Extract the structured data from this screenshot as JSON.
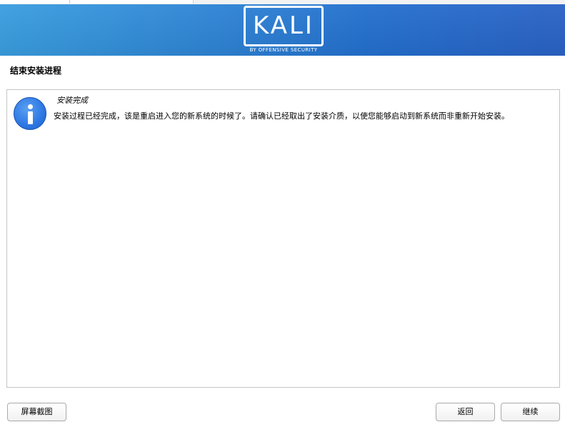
{
  "header": {
    "logo_text": "KALI",
    "logo_subtitle": "BY OFFENSIVE SECURITY",
    "gradient_colors": [
      "#3a9ee0",
      "#2370cf",
      "#2a62c6"
    ]
  },
  "step": {
    "title": "结束安装进程"
  },
  "message": {
    "icon": "info-icon",
    "title": "安装完成",
    "body": "安装过程已经完成，该是重启进入您的新系统的时候了。请确认已经取出了安装介质，以使您能够启动到新系统而非重新开始安装。"
  },
  "buttons": {
    "screenshot": "屏幕截图",
    "back": "返回",
    "continue": "继续"
  }
}
